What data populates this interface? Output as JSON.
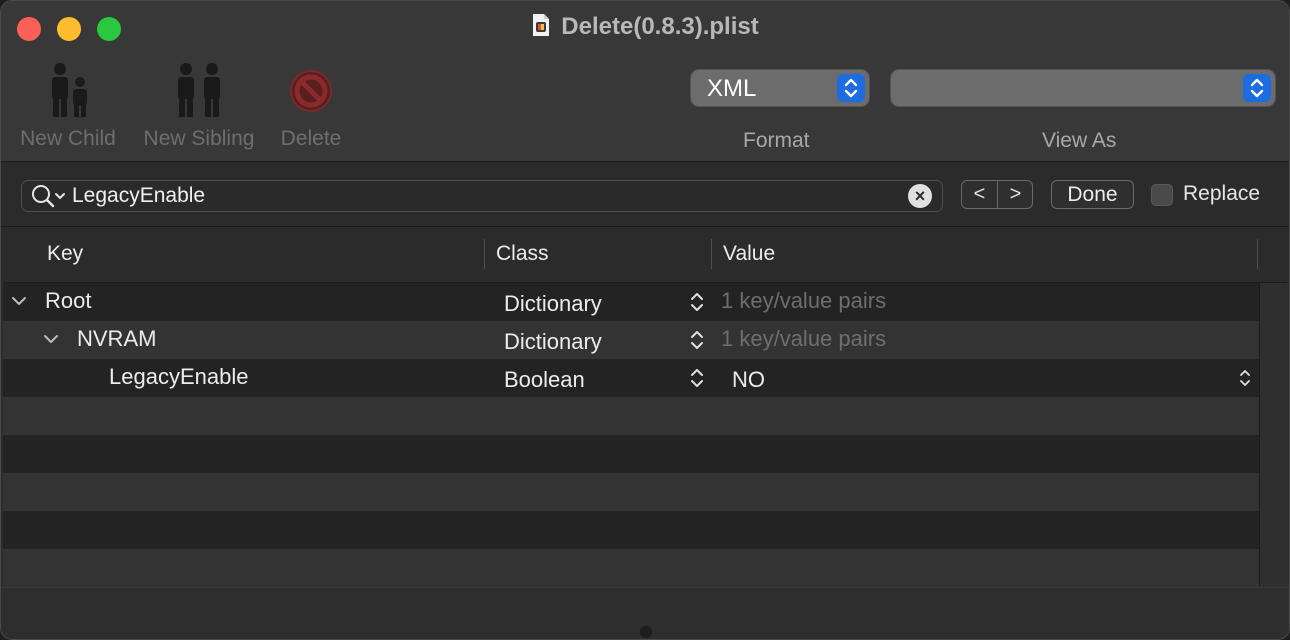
{
  "window": {
    "title": "Delete(0.8.3).plist"
  },
  "toolbar": {
    "new_child": "New Child",
    "new_sibling": "New Sibling",
    "delete": "Delete",
    "format_value": "XML",
    "format_label": "Format",
    "viewas_value": "",
    "viewas_label": "View As"
  },
  "find": {
    "query": "LegacyEnable",
    "prev": "<",
    "next": ">",
    "done": "Done",
    "replace_label": "Replace",
    "replace_checked": false
  },
  "table": {
    "columns": [
      "Key",
      "Class",
      "Value"
    ],
    "rows": [
      {
        "key": "Root",
        "class": "Dictionary",
        "value": "1 key/value pairs",
        "expanded": true
      },
      {
        "key": "NVRAM",
        "class": "Dictionary",
        "value": "1 key/value pairs",
        "expanded": true
      },
      {
        "key": "LegacyEnable",
        "class": "Boolean",
        "value": "NO"
      }
    ]
  },
  "colors": {
    "accent": "#1d6ce0",
    "close": "#fe5f57",
    "minimize": "#febc2e",
    "maximize": "#28c840"
  }
}
